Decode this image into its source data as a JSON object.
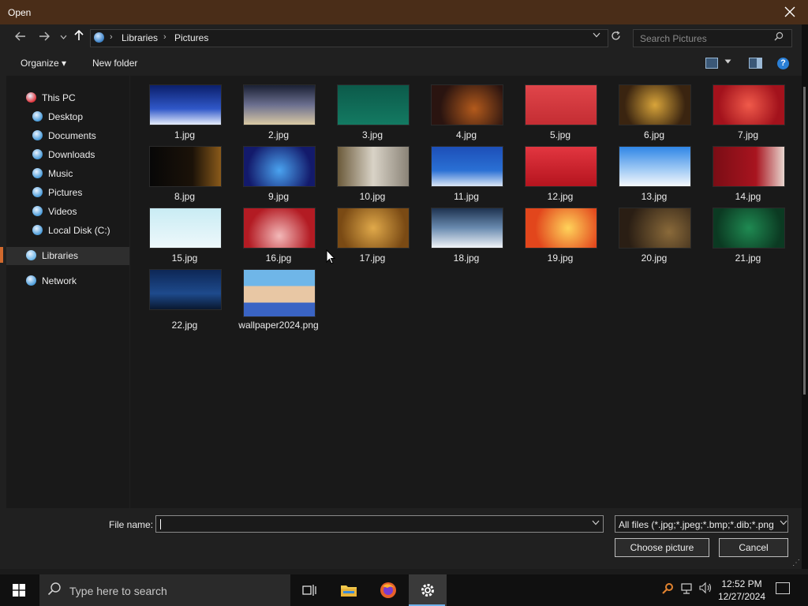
{
  "window": {
    "title": "Open"
  },
  "address": {
    "crumbs": [
      "Libraries",
      "Pictures"
    ]
  },
  "search": {
    "placeholder": "Search Pictures"
  },
  "toolbar": {
    "organize": "Organize ▾",
    "new_folder": "New folder",
    "help": "?"
  },
  "sidebar": {
    "items": [
      {
        "label": "This PC",
        "icon": "this-pc-icon",
        "color": "#e0343b"
      },
      {
        "label": "Desktop",
        "icon": "desktop-icon",
        "color": "#4a9bd9"
      },
      {
        "label": "Documents",
        "icon": "documents-icon",
        "color": "#4a9bd9"
      },
      {
        "label": "Downloads",
        "icon": "downloads-icon",
        "color": "#4a9bd9"
      },
      {
        "label": "Music",
        "icon": "music-icon",
        "color": "#4a9bd9"
      },
      {
        "label": "Pictures",
        "icon": "pictures-icon",
        "color": "#4a9bd9"
      },
      {
        "label": "Videos",
        "icon": "videos-icon",
        "color": "#4a9bd9"
      },
      {
        "label": "Local Disk (C:)",
        "icon": "local-disk-icon",
        "color": "#4a9bd9"
      },
      {
        "label": "Libraries",
        "icon": "libraries-icon",
        "color": "#6bb5e8"
      },
      {
        "label": "Network",
        "icon": "network-icon",
        "color": "#4a9bd9"
      }
    ]
  },
  "files": [
    {
      "name": "1.jpg",
      "bg": "linear-gradient(180deg,#0b1f6b,#3058c9 60%,#e7eefc)"
    },
    {
      "name": "2.jpg",
      "bg": "linear-gradient(180deg,#1a2033,#6b6f8f 50%,#d9c9a3)"
    },
    {
      "name": "3.jpg",
      "bg": "linear-gradient(180deg,#0c5a4a,#137a62)"
    },
    {
      "name": "4.jpg",
      "bg": "radial-gradient(circle at 60% 60%,#b35a1c,#2a1410 70%)"
    },
    {
      "name": "5.jpg",
      "bg": "linear-gradient(180deg,#e0454a,#c42d33)"
    },
    {
      "name": "6.jpg",
      "bg": "radial-gradient(circle at 50% 50%,#d8a43a,#3a2410 75%)"
    },
    {
      "name": "7.jpg",
      "bg": "radial-gradient(circle at 50% 50%,#f05a4a,#a3121c 75%)"
    },
    {
      "name": "8.jpg",
      "bg": "linear-gradient(90deg,#070707,#1b1208 60%,#8a5a1a)"
    },
    {
      "name": "9.jpg",
      "bg": "radial-gradient(circle at 50% 60%,#4aa3f0,#131a6b 75%)"
    },
    {
      "name": "10.jpg",
      "bg": "linear-gradient(90deg,#6b5a3a,#d9d3c7 50%,#8a8377)"
    },
    {
      "name": "11.jpg",
      "bg": "linear-gradient(180deg,#1d4fb8,#2a70d4 60%,#dbe6f5)"
    },
    {
      "name": "12.jpg",
      "bg": "linear-gradient(180deg,#e23640,#b5141e)"
    },
    {
      "name": "13.jpg",
      "bg": "linear-gradient(180deg,#2f86e6,#a5cdf5 60%,#f5f8fc)"
    },
    {
      "name": "14.jpg",
      "bg": "linear-gradient(90deg,#7a0d15,#a8141f 60%,#e8d6cf)"
    },
    {
      "name": "15.jpg",
      "bg": "linear-gradient(180deg,#c9ecf4,#eef8fb)"
    },
    {
      "name": "16.jpg",
      "bg": "radial-gradient(circle at 50% 70%,#f3b9b9,#b31b23 70%)"
    },
    {
      "name": "17.jpg",
      "bg": "radial-gradient(circle at 50% 50%,#e0a94a,#7a4a14 80%)"
    },
    {
      "name": "18.jpg",
      "bg": "linear-gradient(180deg,#1f3350,#6a8bb0 50%,#f1f4f8)"
    },
    {
      "name": "19.jpg",
      "bg": "radial-gradient(circle at 60% 50%,#ffd35a,#e2461c 70%)"
    },
    {
      "name": "20.jpg",
      "bg": "radial-gradient(circle at 70% 60%,#8a6a3a,#2a1e14 75%)"
    },
    {
      "name": "21.jpg",
      "bg": "radial-gradient(circle at 50% 50%,#1f8a52,#0b3a22 80%)"
    },
    {
      "name": "22.jpg",
      "bg": "linear-gradient(180deg,#0d2756,#1e4a8c 60%,#0a1830)"
    },
    {
      "name": "wallpaper2024.png",
      "bg": "linear-gradient(180deg,#6fb6e8 0%,#6fb6e8 35%,#e8c7a4 35%,#e8c7a4 70%,#3a64c4 70%)"
    }
  ],
  "footer": {
    "file_name_label": "File name:",
    "file_name_value": "",
    "filter_text": "All files (*.jpg;*.jpeg;*.bmp;*.dib;*.png",
    "choose_label": "Choose picture",
    "cancel_label": "Cancel"
  },
  "taskbar": {
    "search_placeholder": "Type here to search",
    "time": "12:52 PM",
    "date": "12/27/2024"
  },
  "colors": {
    "titlebar": "#4a2d18",
    "accent": "#d1692d"
  }
}
